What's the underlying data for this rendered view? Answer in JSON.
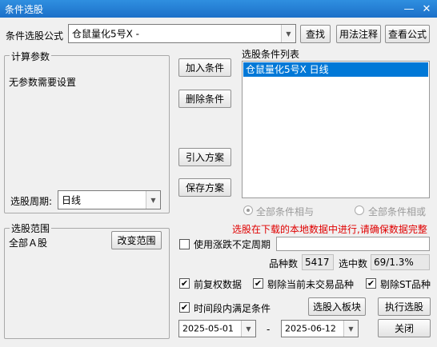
{
  "window": {
    "title": "条件选股",
    "minimize": "—",
    "close": "✕"
  },
  "formula": {
    "label": "条件选股公式",
    "value": "仓鼠量化5号X  -"
  },
  "toolbar": {
    "find": "查找",
    "usage": "用法注释",
    "view": "查看公式"
  },
  "params": {
    "group_title": "计算参数",
    "message": "无参数需要设置",
    "period_label": "选股周期:",
    "period_value": "日线"
  },
  "conditions": {
    "add": "加入条件",
    "delete": "删除条件",
    "import": "引入方案",
    "save": "保存方案",
    "list_title": "选股条件列表",
    "items": [
      "仓鼠量化5号X  日线"
    ],
    "radio_and": "全部条件相与",
    "radio_or": "全部条件相或"
  },
  "range": {
    "group_title": "选股范围",
    "value": "全部Ａ股",
    "change": "改变范围"
  },
  "notice": "选股在下载的本地数据中进行,请确保数据完整",
  "uncertain": {
    "label": "使用涨跌不定周期",
    "checked": false
  },
  "stats": {
    "count_label": "品种数",
    "count_value": "5417",
    "hit_label": "选中数",
    "hit_value": "69/1.3%"
  },
  "options": {
    "adjust": {
      "label": "前复权数据",
      "checked": true
    },
    "exclude_untraded": {
      "label": "剔除当前未交易品种",
      "checked": true
    },
    "exclude_st": {
      "label": "剔除ST品种",
      "checked": true
    },
    "period_cond": {
      "label": "时间段内满足条件",
      "checked": true
    }
  },
  "dates": {
    "start": "2025-05-01",
    "sep": "-",
    "end": "2025-06-12"
  },
  "actions": {
    "to_block": "选股入板块",
    "execute": "执行选股",
    "close": "关闭"
  },
  "icons": {
    "check": "✔",
    "dropdown": "▼"
  },
  "colors": {
    "title_bar": "#1c70c8",
    "selection": "#0078d7",
    "notice": "#e00000"
  }
}
